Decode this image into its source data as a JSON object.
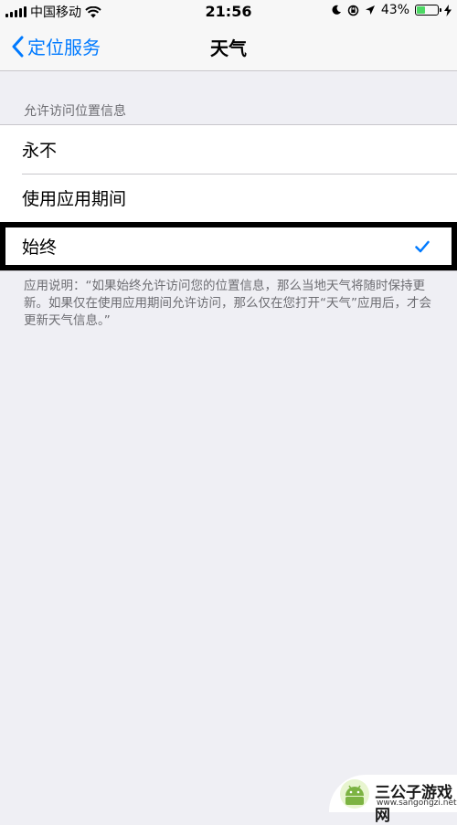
{
  "status": {
    "carrier": "中国移动",
    "time": "21:56",
    "battery_text": "43%",
    "battery_level": 0.43,
    "battery_color": "#4cd964"
  },
  "nav": {
    "back_label": "定位服务",
    "title": "天气"
  },
  "section": {
    "header": "允许访问位置信息",
    "options": [
      {
        "label": "永不",
        "selected": false
      },
      {
        "label": "使用应用期间",
        "selected": false
      },
      {
        "label": "始终",
        "selected": true
      }
    ],
    "footer": "应用说明：“如果始终允许访问您的位置信息，那么当地天气将随时保持更新。如果仅在使用应用期间允许访问，那么仅在您打开“天气”应用后，才会更新天气信息。”"
  },
  "watermark": {
    "name": "三公子游戏网",
    "url": "www.sangongzi.net"
  },
  "colors": {
    "accent": "#007aff",
    "background": "#efeff4"
  }
}
